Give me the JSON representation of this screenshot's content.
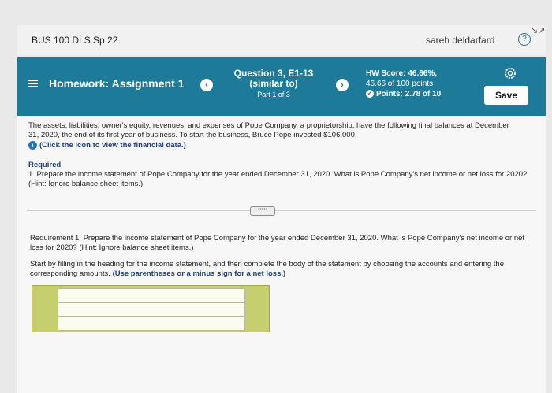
{
  "header": {
    "course": "BUS 100 DLS Sp 22",
    "user": "sareh deldarfard",
    "help_glyph": "?",
    "corner_glyph": "↘↗"
  },
  "hwbar": {
    "title": "Homework: Assignment 1",
    "prev": "‹",
    "next": "›",
    "question_title": "Question 3, E1-13",
    "question_sub": "(similar to)",
    "part": "Part 1 of 3",
    "score_line1": "HW Score: 46.66%,",
    "score_line2": "46.66 of 100 points",
    "points_line": "Points: 2.78 of 10",
    "save_label": "Save",
    "check_glyph": "✓"
  },
  "content": {
    "intro": "The assets, liabilities, owner's equity, revenues, and expenses of Pope Company, a proprietorship, have the following final balances at December 31, 2020, the end of its first year of business. To start the business, Bruce Pope invested $106,000.",
    "info_icon_glyph": "i",
    "info_link": "(Click the icon to view the financial data.)",
    "required_heading": "Required",
    "required_item": "1. Prepare the income statement of Pope Company for the year ended December 31, 2020. What is Pope Company's net income or net loss for 2020? (Hint: Ignore balance sheet items.)",
    "expander": "•••••",
    "req1_text": "Requirement 1. Prepare the income statement of Pope Company for the year ended December 31, 2020. What is Pope Company's net income or net loss for 2020? (Hint: Ignore balance sheet items.)",
    "req1_instr": "Start by filling in the heading for the income statement, and then complete the body of the statement by choosing the accounts and entering the corresponding amounts.",
    "req1_instr_bold": "(Use parentheses or a minus sign for a net loss.)"
  },
  "answer": {
    "inputs": [
      "",
      "",
      ""
    ]
  },
  "colors": {
    "bar": "#1e7a99",
    "answer_bg": "#c5cf6f"
  }
}
